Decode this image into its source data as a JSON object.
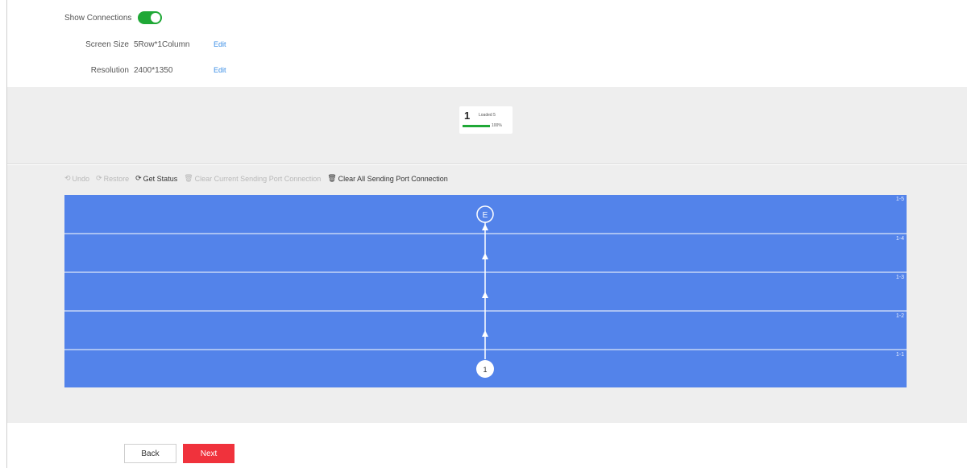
{
  "settings": {
    "show_connections_label": "Show Connections",
    "show_connections_on": true,
    "screen_size_label": "Screen Size",
    "screen_size_value": "5Row*1Column",
    "resolution_label": "Resolution",
    "resolution_value": "2400*1350",
    "edit_label": "Edit"
  },
  "sender_card": {
    "number": "1",
    "status": "Loaded 5",
    "progress_percent": 100,
    "progress_label": "100%"
  },
  "toolbar": {
    "undo": "Undo",
    "restore": "Restore",
    "get_status": "Get Status",
    "clear_current": "Clear Current Sending Port Connection",
    "clear_all": "Clear All Sending Port Connection"
  },
  "screen": {
    "rows": [
      "1-5",
      "1-4",
      "1-3",
      "1-2",
      "1-1"
    ],
    "start_marker": "1",
    "end_marker": "E",
    "fill_color": "#5383ea"
  },
  "footer": {
    "back": "Back",
    "next": "Next"
  },
  "colors": {
    "accent_green": "#1fa836",
    "next_red": "#f0323c",
    "link_blue": "#3a8ee6"
  }
}
